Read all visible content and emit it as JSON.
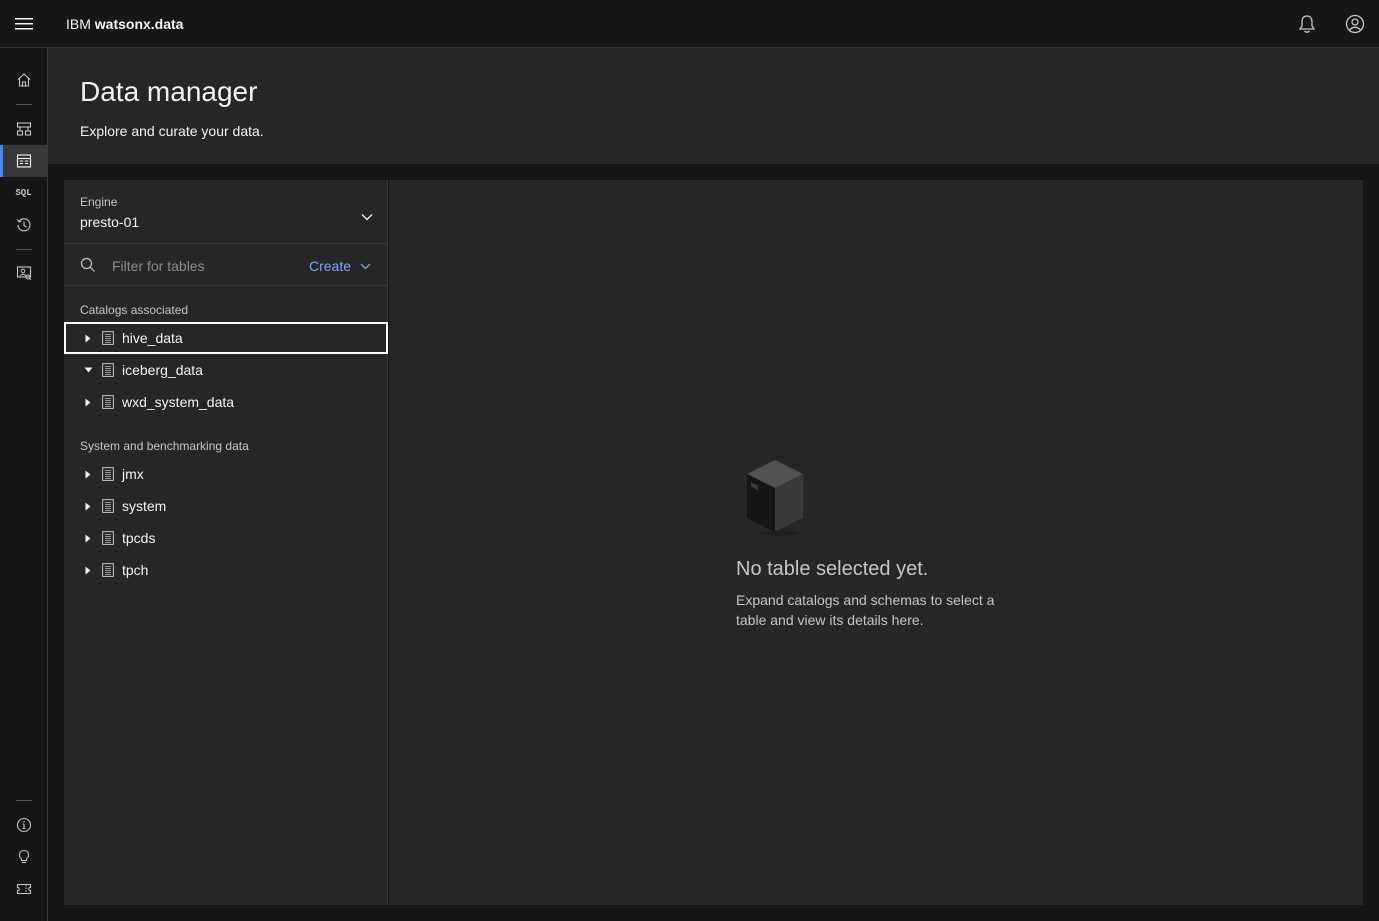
{
  "header": {
    "brand_prefix": "IBM",
    "brand_product": "watsonx.data"
  },
  "rail": {
    "items": [
      {
        "name": "home-icon"
      },
      {
        "name": "infrastructure-icon"
      },
      {
        "name": "data-manager-icon",
        "active": true
      },
      {
        "name": "sql-icon",
        "text": "SQL"
      },
      {
        "name": "query-history-icon"
      },
      {
        "name": "access-control-icon"
      },
      {
        "name": "info-icon"
      },
      {
        "name": "lightbulb-icon"
      },
      {
        "name": "ticket-icon"
      }
    ]
  },
  "page": {
    "title": "Data manager",
    "subtitle": "Explore and curate your data."
  },
  "engine": {
    "label": "Engine",
    "value": "presto-01"
  },
  "filter": {
    "placeholder": "Filter for tables",
    "create_label": "Create"
  },
  "catalogs": {
    "label": "Catalogs associated",
    "items": [
      {
        "label": "hive_data",
        "expanded": false,
        "focused": true
      },
      {
        "label": "iceberg_data",
        "expanded": true
      },
      {
        "label": "wxd_system_data",
        "expanded": false
      }
    ]
  },
  "system": {
    "label": "System and benchmarking data",
    "items": [
      {
        "label": "jmx"
      },
      {
        "label": "system"
      },
      {
        "label": "tpcds"
      },
      {
        "label": "tpch"
      }
    ]
  },
  "empty_state": {
    "title": "No table selected yet.",
    "description": "Expand catalogs and schemas to select a table and view its details here."
  },
  "colors": {
    "accent": "#4589ff",
    "link": "#78a9ff",
    "background": "#161616",
    "layer": "#262626"
  }
}
